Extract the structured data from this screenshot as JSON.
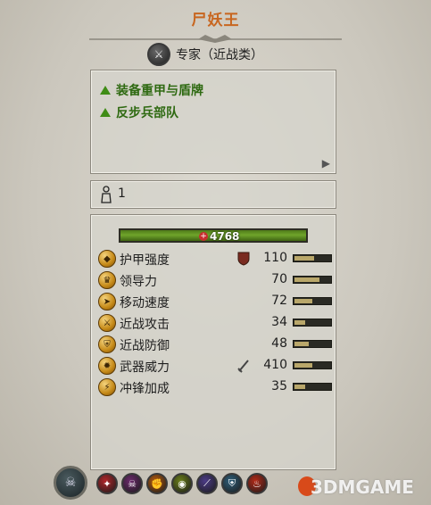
{
  "unit": {
    "name": "尸妖王",
    "class_label": "专家（近战类）",
    "traits": [
      "装备重甲与盾牌",
      "反步兵部队"
    ],
    "entity_count": "1",
    "hp": "4768"
  },
  "stats": [
    {
      "label": "护甲强度",
      "value": "110",
      "fill": 0.55,
      "icon": "armor-icon",
      "has_extra": true,
      "extra_icon": "shield-icon"
    },
    {
      "label": "领导力",
      "value": "70",
      "fill": 0.7,
      "icon": "leadership-icon",
      "has_extra": false
    },
    {
      "label": "移动速度",
      "value": "72",
      "fill": 0.5,
      "icon": "speed-icon",
      "has_extra": false
    },
    {
      "label": "近战攻击",
      "value": "34",
      "fill": 0.3,
      "icon": "melee-attack-icon",
      "has_extra": false
    },
    {
      "label": "近战防御",
      "value": "48",
      "fill": 0.4,
      "icon": "melee-defence-icon",
      "has_extra": false
    },
    {
      "label": "武器威力",
      "value": "410",
      "fill": 0.5,
      "icon": "weapon-strength-icon",
      "has_extra": true,
      "extra_icon": "sword-icon"
    },
    {
      "label": "冲锋加成",
      "value": "35",
      "fill": 0.3,
      "icon": "charge-bonus-icon",
      "has_extra": false
    }
  ],
  "abilities": [
    {
      "icon": "frenzy-icon",
      "color": "#b0262a"
    },
    {
      "icon": "skull-icon",
      "color": "#6b2a6b"
    },
    {
      "icon": "fist-icon",
      "color": "#b35a0f"
    },
    {
      "icon": "eye-icon",
      "color": "#6a7d1a"
    },
    {
      "icon": "claw-icon",
      "color": "#4b3b86"
    },
    {
      "icon": "shield-badge-icon",
      "color": "#2f5f7a"
    },
    {
      "icon": "fire-icon",
      "color": "#b32a18"
    }
  ],
  "watermark": "3DMGAME",
  "colors": {
    "title": "#c8661f",
    "trait_green": "#2f6a12",
    "hp_green": "#6fa42b"
  }
}
